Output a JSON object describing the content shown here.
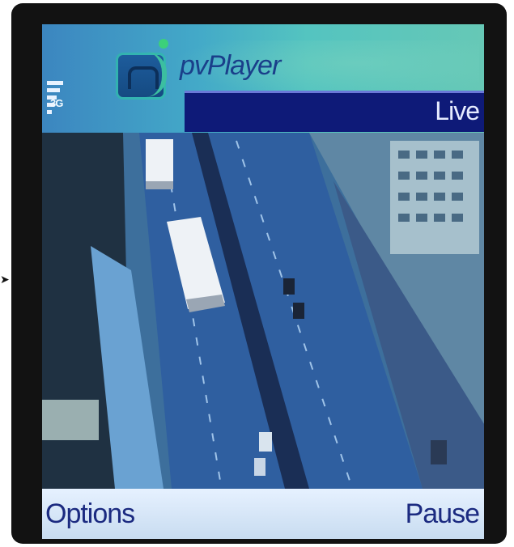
{
  "app": {
    "title": "pvPlayer",
    "status_label": "Live"
  },
  "status_bar": {
    "network": "3G",
    "signal_bars": 5
  },
  "video": {
    "description_icon": "camera-feed"
  },
  "softkeys": {
    "left_label": "Options",
    "right_label": "Pause"
  },
  "colors": {
    "header_start": "#3c86c0",
    "header_end": "#66c8b6",
    "live_bar": "#0e1a78",
    "softkey_bg": "#e6f1ff",
    "softkey_text": "#1b2a80"
  }
}
